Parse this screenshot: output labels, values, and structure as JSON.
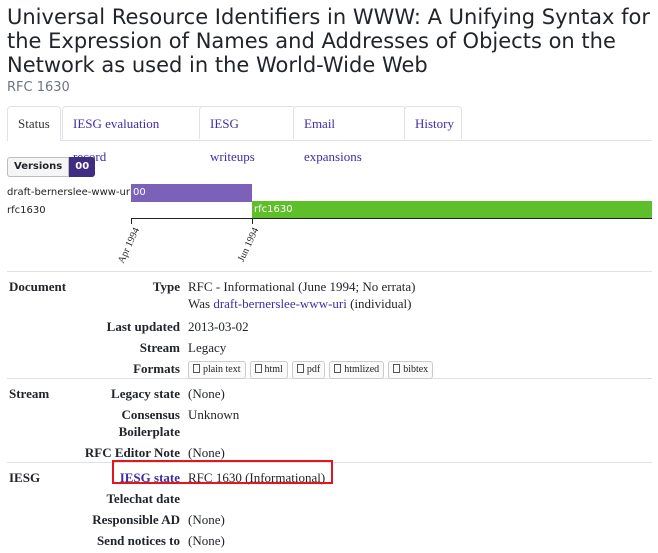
{
  "page": {
    "title": "Universal Resource Identifiers in WWW: A Unifying Syntax for the Expression of Names and Addresses of Objects on the Network as used in the World-Wide Web",
    "subtitle": "RFC 1630"
  },
  "tabs": [
    "Status",
    "IESG evaluation record",
    "IESG writeups",
    "Email expansions",
    "History"
  ],
  "versions": {
    "label": "Versions",
    "items": [
      "00"
    ]
  },
  "timeline": {
    "rows": [
      {
        "label": "draft-bernerslee-www-uri",
        "bar_label": "00",
        "color": "#7b62b8"
      },
      {
        "label": "rfc1630",
        "bar_label": "rfc1630",
        "color": "#5fbf2a"
      }
    ],
    "ticks": [
      "Apr 1994",
      "Jun 1994"
    ]
  },
  "document": {
    "section": "Document",
    "type_label": "Type",
    "type_value": "RFC - Informational (June 1994; No errata)",
    "was_prefix": "Was",
    "was_link": "draft-bernerslee-www-uri",
    "was_suffix": "(individual)",
    "last_updated_label": "Last updated",
    "last_updated_value": "2013-03-02",
    "stream_label": "Stream",
    "stream_value": "Legacy",
    "formats_label": "Formats",
    "formats": [
      "plain text",
      "html",
      "pdf",
      "htmlized",
      "bibtex"
    ]
  },
  "stream": {
    "section": "Stream",
    "legacy_state_label": "Legacy state",
    "legacy_state_value": "(None)",
    "consensus_label_1": "Consensus",
    "consensus_label_2": "Boilerplate",
    "consensus_value": "Unknown",
    "rfc_editor_note_label": "RFC Editor Note",
    "rfc_editor_note_value": "(None)"
  },
  "iesg": {
    "section": "IESG",
    "iesg_state_label": "IESG state",
    "iesg_state_value": "RFC 1630 (Informational)",
    "telechat_label": "Telechat date",
    "responsible_ad_label": "Responsible AD",
    "responsible_ad_value": "(None)",
    "send_notices_label": "Send notices to",
    "send_notices_value": "(None)"
  },
  "colors": {
    "link": "#3d2ea6",
    "highlight": "#e3161b"
  }
}
